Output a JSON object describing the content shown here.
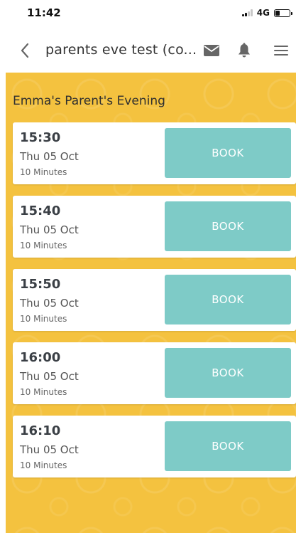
{
  "status_bar": {
    "time": "11:42",
    "network": "4G"
  },
  "nav": {
    "back_icon": "chevron-left-icon",
    "title": "parents eve test (co...",
    "mail_icon": "envelope-icon",
    "bell_icon": "bell-icon",
    "menu_icon": "hamburger-menu-icon"
  },
  "page": {
    "heading": "Emma's Parent's Evening",
    "book_label": "BOOK",
    "slots": [
      {
        "time": "15:30",
        "date": "Thu 05 Oct",
        "duration": "10 Minutes"
      },
      {
        "time": "15:40",
        "date": "Thu 05 Oct",
        "duration": "10 Minutes"
      },
      {
        "time": "15:50",
        "date": "Thu 05 Oct",
        "duration": "10 Minutes"
      },
      {
        "time": "16:00",
        "date": "Thu 05 Oct",
        "duration": "10 Minutes"
      },
      {
        "time": "16:10",
        "date": "Thu 05 Oct",
        "duration": "10 Minutes"
      }
    ]
  },
  "colors": {
    "background": "#f4c23f",
    "book_button": "#7ecbc7",
    "card": "#ffffff"
  }
}
